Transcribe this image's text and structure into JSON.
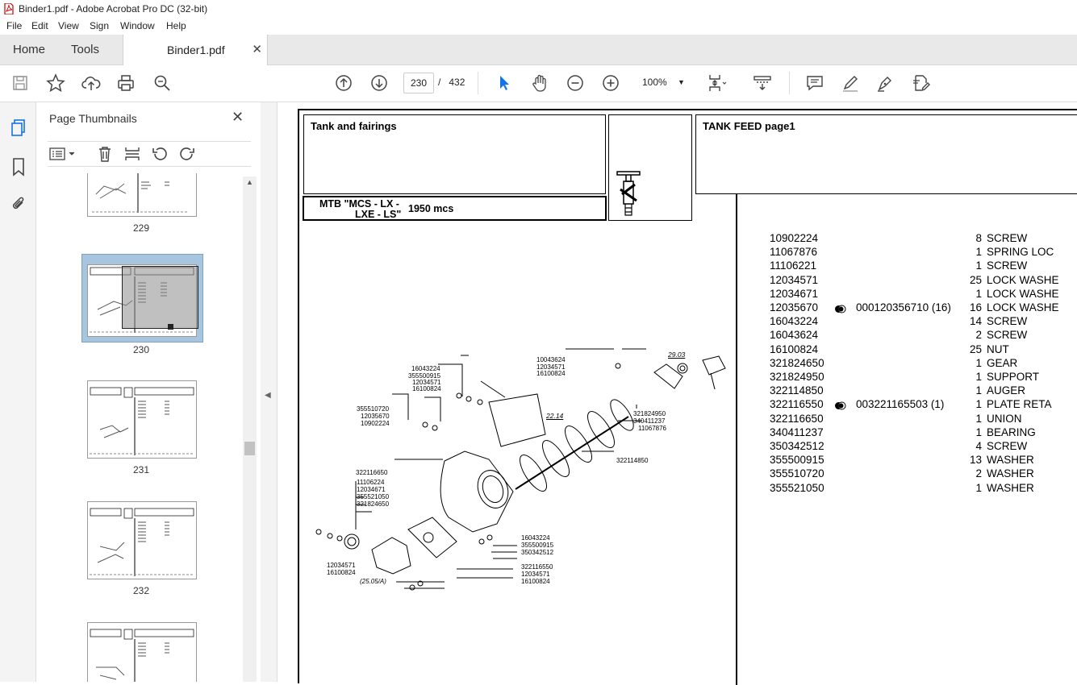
{
  "window": {
    "title": "Binder1.pdf - Adobe Acrobat Pro DC (32-bit)"
  },
  "menu": [
    "File",
    "Edit",
    "View",
    "Sign",
    "Window",
    "Help"
  ],
  "tabs": {
    "home": "Home",
    "tools": "Tools",
    "document": "Binder1.pdf"
  },
  "toolbar": {
    "current_page": "230",
    "page_sep": "/",
    "total_pages": "432",
    "zoom": "100%"
  },
  "thumbnails": {
    "title": "Page Thumbnails",
    "pages": [
      {
        "label": "229",
        "selected": false
      },
      {
        "label": "230",
        "selected": true
      },
      {
        "label": "231",
        "selected": false
      },
      {
        "label": "232",
        "selected": false
      },
      {
        "label": "",
        "selected": false
      }
    ]
  },
  "document": {
    "section_title": "Tank and fairings",
    "model": "MTB \"MCS - LX -\n LXE - LS\"",
    "model_line1": "MTB \"MCS - LX -",
    "model_line2": "LXE - LS\"",
    "model_value": "1950  mcs",
    "group_title": "TANK FEED  page1",
    "parts": [
      {
        "code": "10902224",
        "ref": "",
        "qty": "8",
        "desc": "SCREW"
      },
      {
        "code": "11067876",
        "ref": "",
        "qty": "1",
        "desc": "SPRING LOC"
      },
      {
        "code": "11106221",
        "ref": "",
        "qty": "1",
        "desc": "SCREW"
      },
      {
        "code": "12034571",
        "ref": "",
        "qty": "25",
        "desc": "LOCK WASHE"
      },
      {
        "code": "12034671",
        "ref": "",
        "qty": "1",
        "desc": "LOCK WASHE"
      },
      {
        "code": "12035670",
        "ref": "000120356710  (16)",
        "qty": "16",
        "desc": "LOCK WASHE"
      },
      {
        "code": "16043224",
        "ref": "",
        "qty": "14",
        "desc": "SCREW"
      },
      {
        "code": "16043624",
        "ref": "",
        "qty": "2",
        "desc": "SCREW"
      },
      {
        "code": "16100824",
        "ref": "",
        "qty": "25",
        "desc": "NUT"
      },
      {
        "code": "321824650",
        "ref": "",
        "qty": "1",
        "desc": "GEAR"
      },
      {
        "code": "321824950",
        "ref": "",
        "qty": "1",
        "desc": "SUPPORT"
      },
      {
        "code": "322114850",
        "ref": "",
        "qty": "1",
        "desc": "AUGER"
      },
      {
        "code": "322116550",
        "ref": "003221165503  (1)",
        "qty": "1",
        "desc": "PLATE RETA"
      },
      {
        "code": "322116650",
        "ref": "",
        "qty": "1",
        "desc": "UNION"
      },
      {
        "code": "340411237",
        "ref": "",
        "qty": "1",
        "desc": "BEARING"
      },
      {
        "code": "350342512",
        "ref": "",
        "qty": "4",
        "desc": "SCREW"
      },
      {
        "code": "355500915",
        "ref": "",
        "qty": "13",
        "desc": "WASHER"
      },
      {
        "code": "355510720",
        "ref": "",
        "qty": "2",
        "desc": "WASHER"
      },
      {
        "code": "355521050",
        "ref": "",
        "qty": "1",
        "desc": "WASHER"
      }
    ],
    "callouts": {
      "c1": [
        "16043224",
        "355500915",
        "12034571",
        "16100824"
      ],
      "c2": [
        "10043624",
        "12034571",
        "16100824"
      ],
      "c3": "29.03",
      "c4": [
        "355510720",
        "12035670",
        "10902224"
      ],
      "c5": "22.14",
      "c6": [
        "321824950",
        "340411237",
        "11067876"
      ],
      "c7": "322114850",
      "c8": "322116650",
      "c9": [
        "11106224",
        "12034671",
        "355521050",
        "321824650"
      ],
      "c10": [
        "16043224",
        "355500915",
        "350342512"
      ],
      "c11": [
        "12034571",
        "16100824"
      ],
      "c12": "(25.05/A)",
      "c13": [
        "322116550",
        "12034571",
        "16100824"
      ]
    }
  }
}
